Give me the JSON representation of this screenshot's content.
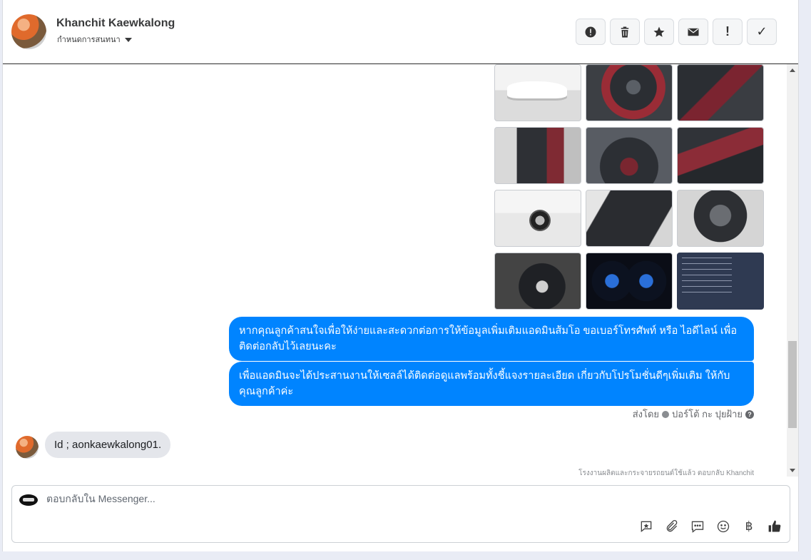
{
  "header": {
    "contact_name": "Khanchit Kaewkalong",
    "assign_label": "กำหนดการสนทนา",
    "toolbar": [
      {
        "name": "spam-button",
        "icon": "alert-circle-icon"
      },
      {
        "name": "delete-button",
        "icon": "trash-icon"
      },
      {
        "name": "star-button",
        "icon": "star-icon"
      },
      {
        "name": "unread-button",
        "icon": "envelope-icon"
      },
      {
        "name": "priority-button",
        "icon": "exclamation-icon",
        "glyph": "!"
      },
      {
        "name": "done-button",
        "icon": "check-icon",
        "glyph": "✓"
      }
    ]
  },
  "messages": {
    "photo_grid": [
      "car-exterior-white",
      "dashboard-interior",
      "gear-shift",
      "front-seats-driver",
      "front-cabin",
      "rear-seats",
      "side-front-wheel",
      "door-panel",
      "engine-bay",
      "steering-wheel",
      "instrument-cluster",
      "inspection-document"
    ],
    "outgoing_1": "หากคุณลูกค้าสนใจเพื่อให้ง่ายและสะดวกต่อการให้ข้อมูลเพิ่มเติมแอดมินส้มโอ ขอเบอร์โทรศัพท์ หรือ ไอดีไลน์ เพื่อติดต่อกลับไว้เลยนะคะ",
    "outgoing_2": "เพื่อแอดมินจะได้ประสานงานให้เซลล์ได้ติดต่อดูแลพร้อมทั้งชี้แจงรายละเอียด เกี่ยวกับโปรโมชั่นดีๆเพิ่มเติม ให้กับคุณลูกค้าค่ะ",
    "sent_by_prefix": "ส่งโดย",
    "sent_by_name": "ปอร์โต้ กะ ปุยฝ้าย",
    "incoming": "Id ; aonkaewkalong01.",
    "footnote": "โรงงานผลิตและกระจายรถยนต์ใช้แล้ว ตอบกลับ Khanchit"
  },
  "composer": {
    "placeholder": "ตอบกลับใน Messenger...",
    "actions": [
      "saved-reply-icon",
      "attachment-icon",
      "message-icon",
      "emoji-icon",
      "baht-icon",
      "thumbs-up-icon"
    ],
    "baht_glyph": "฿"
  }
}
